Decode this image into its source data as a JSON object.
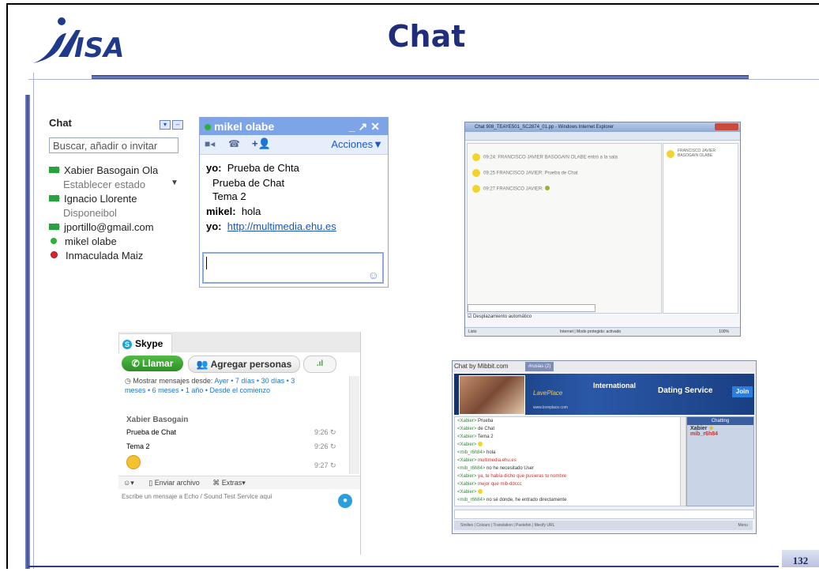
{
  "slide": {
    "title": "Chat",
    "page_number": "132",
    "logo_text": "ISA"
  },
  "gmail_chat": {
    "header": "Chat",
    "search_placeholder": "Buscar, añadir o invitar",
    "contacts": [
      {
        "name": "Xabier Basogain Ola",
        "status_text": "Establecer estado",
        "icon": "video-icon"
      },
      {
        "name": "Ignacio Llorente",
        "status_text": "Disponeibol",
        "icon": "video-icon"
      },
      {
        "name": "jportillo@gmail.com",
        "icon": "video-icon"
      },
      {
        "name": "mikel olabe",
        "icon": "green-dot"
      },
      {
        "name": "Inmaculada Maiz",
        "icon": "red-busy-dot"
      }
    ],
    "status_dropdown": "▼"
  },
  "gmail_chat_window": {
    "title": "mikel olabe",
    "actions_label": "Acciones▼",
    "messages": [
      {
        "sender": "yo:",
        "text": "Prueba de Chta"
      },
      {
        "sender": "",
        "text": "Prueba de Chat"
      },
      {
        "sender": "",
        "text": "Tema 2"
      },
      {
        "sender": "mikel:",
        "text": "hola"
      },
      {
        "sender": "yo:",
        "text": "http://multimedia.ehu.es"
      }
    ]
  },
  "ie_window": {
    "title": "Chat 908_TEAYE501_SC2874_01.pp - Windows Internet Explorer",
    "messages": [
      "09:24: FRANCISCO JAVIER BASOGAIN OLABE entró a la sala",
      "09:25 FRANCISCO JAVIER: Prueba de Chat",
      "09:27 FRANCISCO JAVIER:"
    ],
    "user_panel": "FRANCISCO JAVIER BASOGAIN OLABE",
    "autoscroll_label": "Desplazamiento automático",
    "status_left": "Listo",
    "status_middle": "Internet | Modo protegido: activado",
    "status_right": "100%"
  },
  "skype": {
    "brand": "Skype",
    "call_button": "Llamar",
    "add_people_button": "Agregar personas",
    "show_since_label": "Mostrar mensajes desde:",
    "show_since_options": "Ayer • 7 días • 30 días • 3 meses • 6 meses • 1 año • Desde el comienzo",
    "author": "Xabier Basogain",
    "messages": [
      {
        "text": "Prueba de Chat",
        "time": "9:26"
      },
      {
        "text": "Tema 2",
        "time": "9:26"
      },
      {
        "text": "",
        "time": "9:27"
      }
    ],
    "send_file": "Enviar archivo",
    "extras": "Extras▾",
    "input_placeholder": "Escribe un mensaje a Echo / Sound Test Service aquí"
  },
  "dating_chat": {
    "tab_title": "Chat by Mibbit.com",
    "tab2": "#rusias (2)",
    "banner_left": "LavePlace",
    "banner_center": "International",
    "banner_right": "Dating Service",
    "join": "Join",
    "site": "www.loveplace.com",
    "lines": [
      {
        "who": "<Xabier>",
        "text": "Prueba",
        "color": "#333"
      },
      {
        "who": "<Xabier>",
        "text": "de Chat",
        "color": "#333"
      },
      {
        "who": "<Xabier>",
        "text": "Tema 2",
        "color": "#333"
      },
      {
        "who": "<Xabier>",
        "text": "",
        "color": "#333"
      },
      {
        "who": "<mib_r6h84>",
        "text": "hola",
        "color": "#333"
      },
      {
        "who": "<Xabier>",
        "text": "multimedia.ehu.es",
        "color": "#d0302a"
      },
      {
        "who": "<mib_r6h84>",
        "text": "no he necesitado User",
        "color": "#333"
      },
      {
        "who": "<Xabier>",
        "text": "ya, te había dicho que pusieras tu nombre",
        "color": "#d0302a"
      },
      {
        "who": "<Xabier>",
        "text": "mejor que mib-ddccc",
        "color": "#d0302a"
      },
      {
        "who": "<Xabier>",
        "text": "",
        "color": "#333"
      },
      {
        "who": "<mib_r6h84>",
        "text": "no sé donde, he entrado directamente",
        "color": "#333"
      }
    ],
    "chatting_label": "Chatting",
    "users": [
      "Xabier",
      "mib_r6h84"
    ],
    "footer": "Smilies | Colours | Translation | Pastebin | Mecify URL",
    "footer_right": "Menu"
  },
  "colors": {
    "title_blue": "#1f2d7a",
    "gmail_blue": "#7ea4e8",
    "skype_green": "#3ea33a",
    "dating_blue": "#1d3a8a"
  }
}
